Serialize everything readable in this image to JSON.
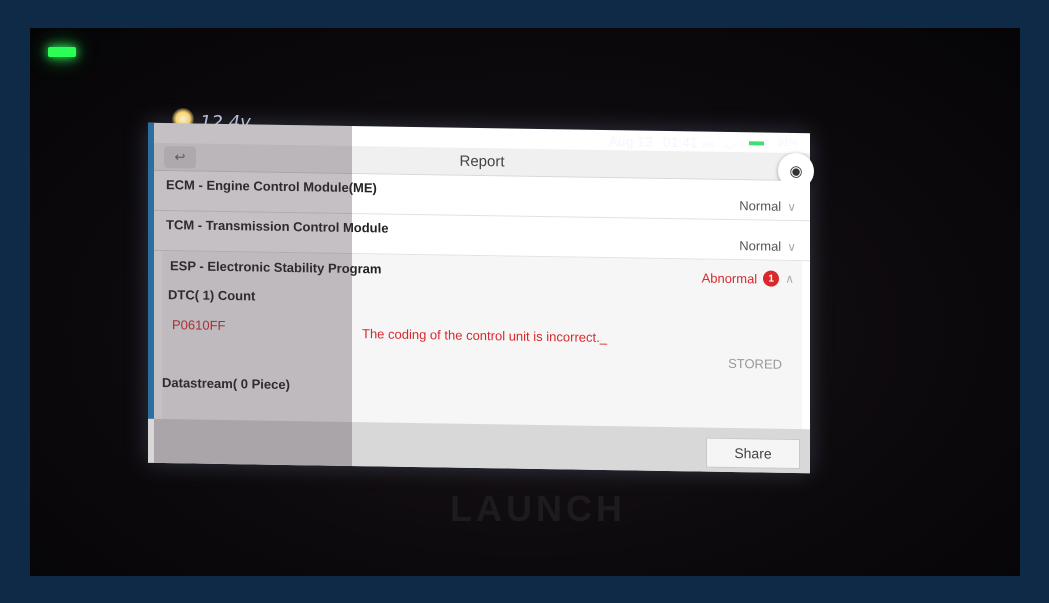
{
  "device": {
    "voltage": "12.4v",
    "brand": "LAUNCH"
  },
  "status_bar": {
    "date": "Aug 13",
    "time": "01:41",
    "ampm": "PM",
    "battery": "91%"
  },
  "header": {
    "title": "Report",
    "back_icon": "back-arrow-icon",
    "camera_icon": "camera-icon"
  },
  "modules": [
    {
      "name": "ECM - Engine Control Module(ME)",
      "status": "Normal"
    },
    {
      "name": "TCM - Transmission Control Module",
      "status": "Normal"
    }
  ],
  "expanded_module": {
    "name": "ESP - Electronic Stability Program",
    "status": "Abnormal",
    "badge_count": "1",
    "dtc_count_label": "DTC( 1) Count",
    "dtc": {
      "code": "P0610FF",
      "description": "The coding of the control unit is incorrect._",
      "state": "STORED"
    },
    "datastream_label": "Datastream( 0 Piece)"
  },
  "footer": {
    "share_label": "Share"
  },
  "colors": {
    "abnormal": "#d8282c",
    "background": "#0f2a47"
  }
}
